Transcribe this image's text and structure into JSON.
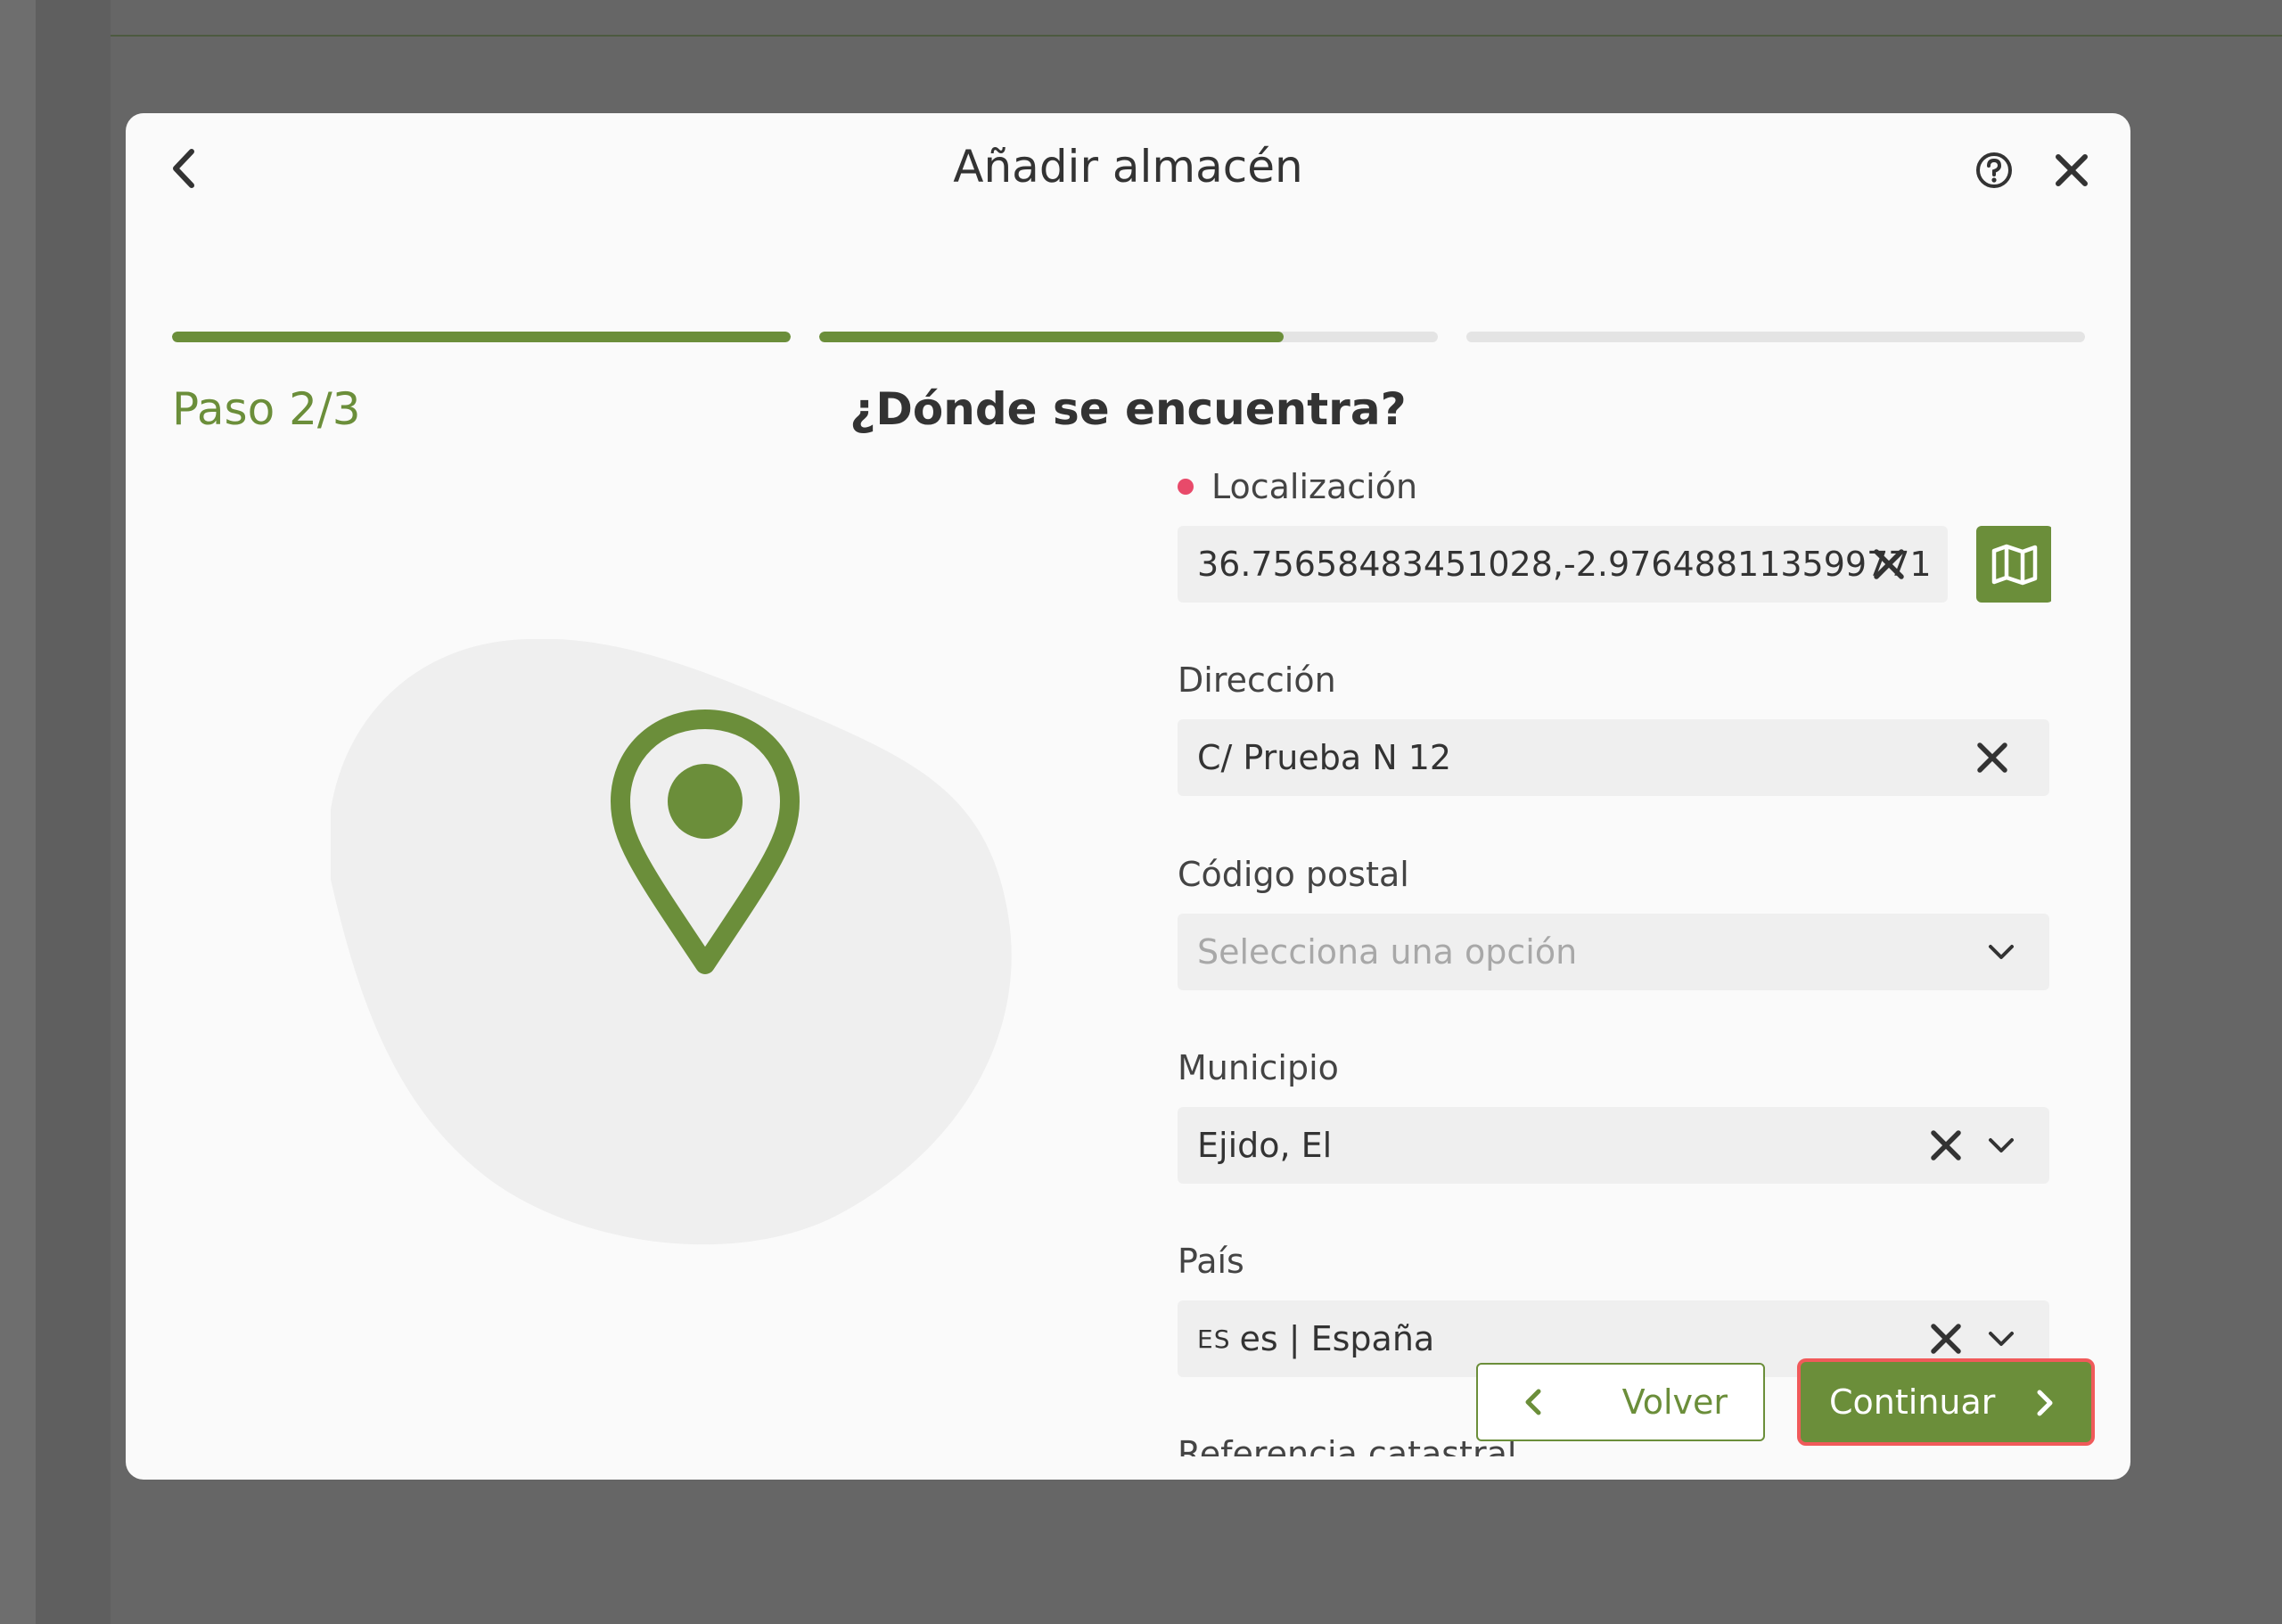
{
  "modal": {
    "title": "Añadir almacén",
    "step_label": "Paso 2/3",
    "step_title": "¿Dónde se encuentra?",
    "progress": [
      1.0,
      0.75,
      0.0
    ]
  },
  "form": {
    "localizacion": {
      "label": "Localización",
      "value": "36.75658483451028,-2.976488113599771",
      "required": true
    },
    "direccion": {
      "label": "Dirección",
      "value": "C/ Prueba N 12"
    },
    "codigo_postal": {
      "label": "Código postal",
      "placeholder": "Selecciona una opción"
    },
    "municipio": {
      "label": "Municipio",
      "value": "Ejido, El"
    },
    "pais": {
      "label": "País",
      "flag": "ES",
      "value": "es | España"
    },
    "referencia_catastral": {
      "label": "Referencia catastral"
    }
  },
  "footer": {
    "back_label": "Volver",
    "continue_label": "Continuar"
  },
  "colors": {
    "accent": "#6b8e3a",
    "required": "#e84a6a",
    "highlight": "#f05a5a"
  },
  "icons": [
    "back-arrow-icon",
    "help-icon",
    "close-icon",
    "map-icon",
    "clear-icon",
    "chevron-down-icon",
    "location-pin-icon",
    "chevron-left-icon",
    "chevron-right-icon"
  ]
}
